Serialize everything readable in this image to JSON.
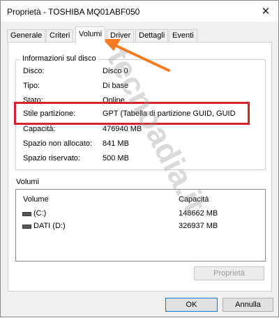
{
  "window": {
    "title": "Proprietà - TOSHIBA MQ01ABF050"
  },
  "tabs": [
    {
      "label": "Generale"
    },
    {
      "label": "Criteri"
    },
    {
      "label": "Volumi",
      "active": true
    },
    {
      "label": "Driver"
    },
    {
      "label": "Dettagli"
    },
    {
      "label": "Eventi"
    }
  ],
  "disk_info": {
    "group_label": "Informazioni sul disco",
    "rows": [
      {
        "label": "Disco:",
        "value": "Disco 0"
      },
      {
        "label": "Tipo:",
        "value": "Di base"
      },
      {
        "label": "Stato:",
        "value": "Online"
      },
      {
        "label": "Stile partizione:",
        "value": "GPT (Tabella di partizione GUID, GUID"
      },
      {
        "label": "Capacità:",
        "value": "476940 MB"
      },
      {
        "label": "Spazio non allocato:",
        "value": "841 MB"
      },
      {
        "label": "Spazio riservato:",
        "value": "500 MB"
      }
    ]
  },
  "volumes": {
    "group_label": "Volumi",
    "columns": [
      "Volume",
      "Capacità"
    ],
    "rows": [
      {
        "name": "(C:)",
        "capacity": "148662 MB"
      },
      {
        "name": "DATI (D:)",
        "capacity": "326937 MB"
      }
    ],
    "properties_button": "Proprietà"
  },
  "buttons": {
    "ok": "OK",
    "cancel": "Annulla"
  },
  "annotation": {
    "highlight_color": "#d2242d",
    "arrow_color": "#f47b20"
  },
  "watermark": "tecnoadia.it"
}
